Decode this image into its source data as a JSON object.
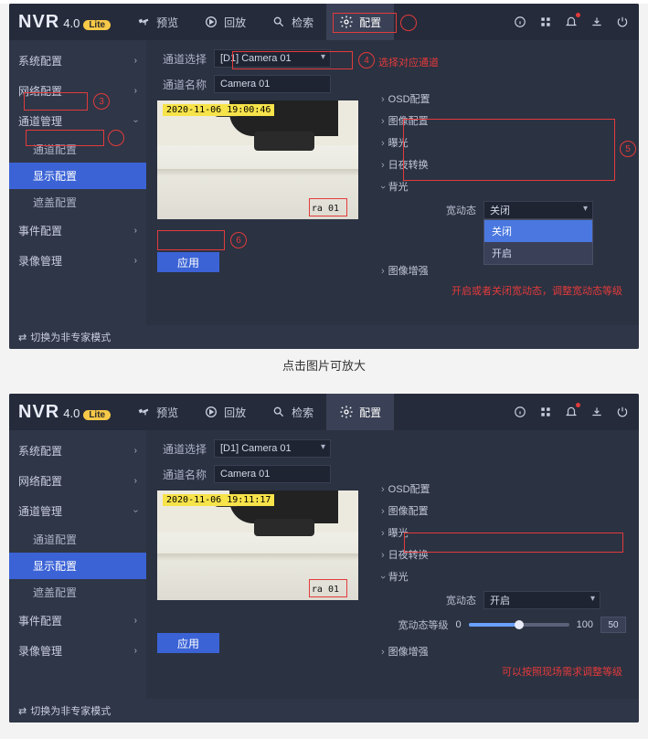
{
  "brand": {
    "name": "NVR",
    "version": "4.0",
    "tag": "Lite"
  },
  "tabs": {
    "preview": "预览",
    "playback": "回放",
    "search": "检索",
    "settings": "配置"
  },
  "sidebar": {
    "system": "系统配置",
    "network": "网络配置",
    "channel": "通道管理",
    "channel_sub_channel": "通道配置",
    "channel_sub_display": "显示配置",
    "channel_sub_mask": "遮盖配置",
    "event": "事件配置",
    "record": "录像管理"
  },
  "form": {
    "channel_select_label": "通道选择",
    "channel_select_value": "[D1] Camera 01",
    "channel_name_label": "通道名称",
    "channel_name_value": "Camera 01"
  },
  "annotations": {
    "select_channel_hint": "选择对应通道",
    "wdr_hint_1": "开启或者关闭宽动态，调整宽动态等级",
    "wdr_hint_2": "可以按照现场需求调整等级"
  },
  "right_panel": {
    "osd": "OSD配置",
    "image": "图像配置",
    "exposure": "曝光",
    "daynight": "日夜转换",
    "backlight": "背光",
    "wdr_label": "宽动态",
    "wdr_value_off": "关闭",
    "wdr_value_on": "开启",
    "wdr_option_off": "关闭",
    "wdr_option_on": "开启",
    "wdr_level_label": "宽动态等级",
    "slider_min": "0",
    "slider_max": "100",
    "slider_value": "50",
    "image_enhance": "图像增强"
  },
  "preview": {
    "ts1": "2020-11-06 19:00:46",
    "ts2": "2020-11-06 19:11:17",
    "cam_label": "ra 01"
  },
  "buttons": {
    "apply": "应用"
  },
  "footer": {
    "toggle_mode": "切换为非专家模式"
  },
  "caption": "点击图片可放大",
  "circles": {
    "c3": "3",
    "c4": "4",
    "c5": "5",
    "c6": "6"
  }
}
